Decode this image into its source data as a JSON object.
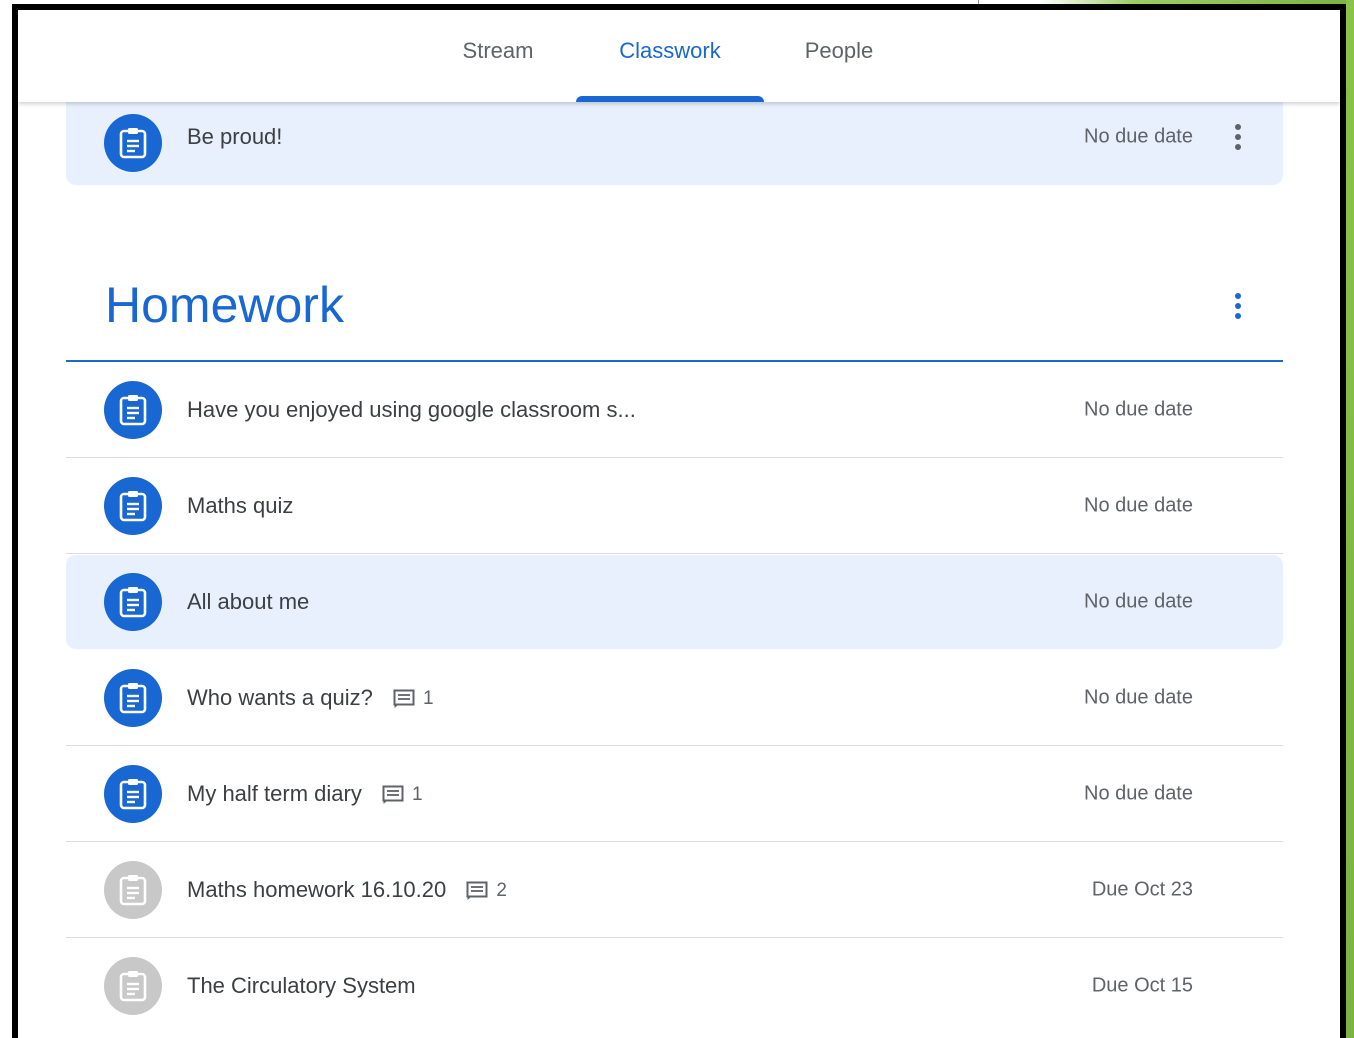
{
  "tabs": [
    {
      "label": "Stream",
      "active": false
    },
    {
      "label": "Classwork",
      "active": true
    },
    {
      "label": "People",
      "active": false
    }
  ],
  "top_item": {
    "title": "Be proud!",
    "due": "No due date",
    "icon": "assignment-icon"
  },
  "topic": {
    "title": "Homework"
  },
  "items": [
    {
      "title": "Have you enjoyed using google classroom s...",
      "due": "No due date",
      "comments": null,
      "icon_color": "#1967d2"
    },
    {
      "title": "Maths quiz",
      "due": "No due date",
      "comments": null,
      "icon_color": "#1967d2"
    },
    {
      "title": "All about me",
      "due": "No due date",
      "comments": null,
      "icon_color": "#1967d2",
      "highlighted": true
    },
    {
      "title": "Who wants a quiz?",
      "due": "No due date",
      "comments": "1",
      "icon_color": "#1967d2"
    },
    {
      "title": "My half term diary",
      "due": "No due date",
      "comments": "1",
      "icon_color": "#1967d2"
    },
    {
      "title": "Maths homework 16.10.20",
      "due": "Due Oct 23",
      "comments": "2",
      "icon_color": "#c8c8c8"
    },
    {
      "title": "The Circulatory System",
      "due": "Due Oct 15",
      "comments": null,
      "icon_color": "#c8c8c8"
    }
  ],
  "colors": {
    "accent": "#1967d2",
    "highlight": "#e8f0fe",
    "muted_icon": "#c8c8c8"
  }
}
